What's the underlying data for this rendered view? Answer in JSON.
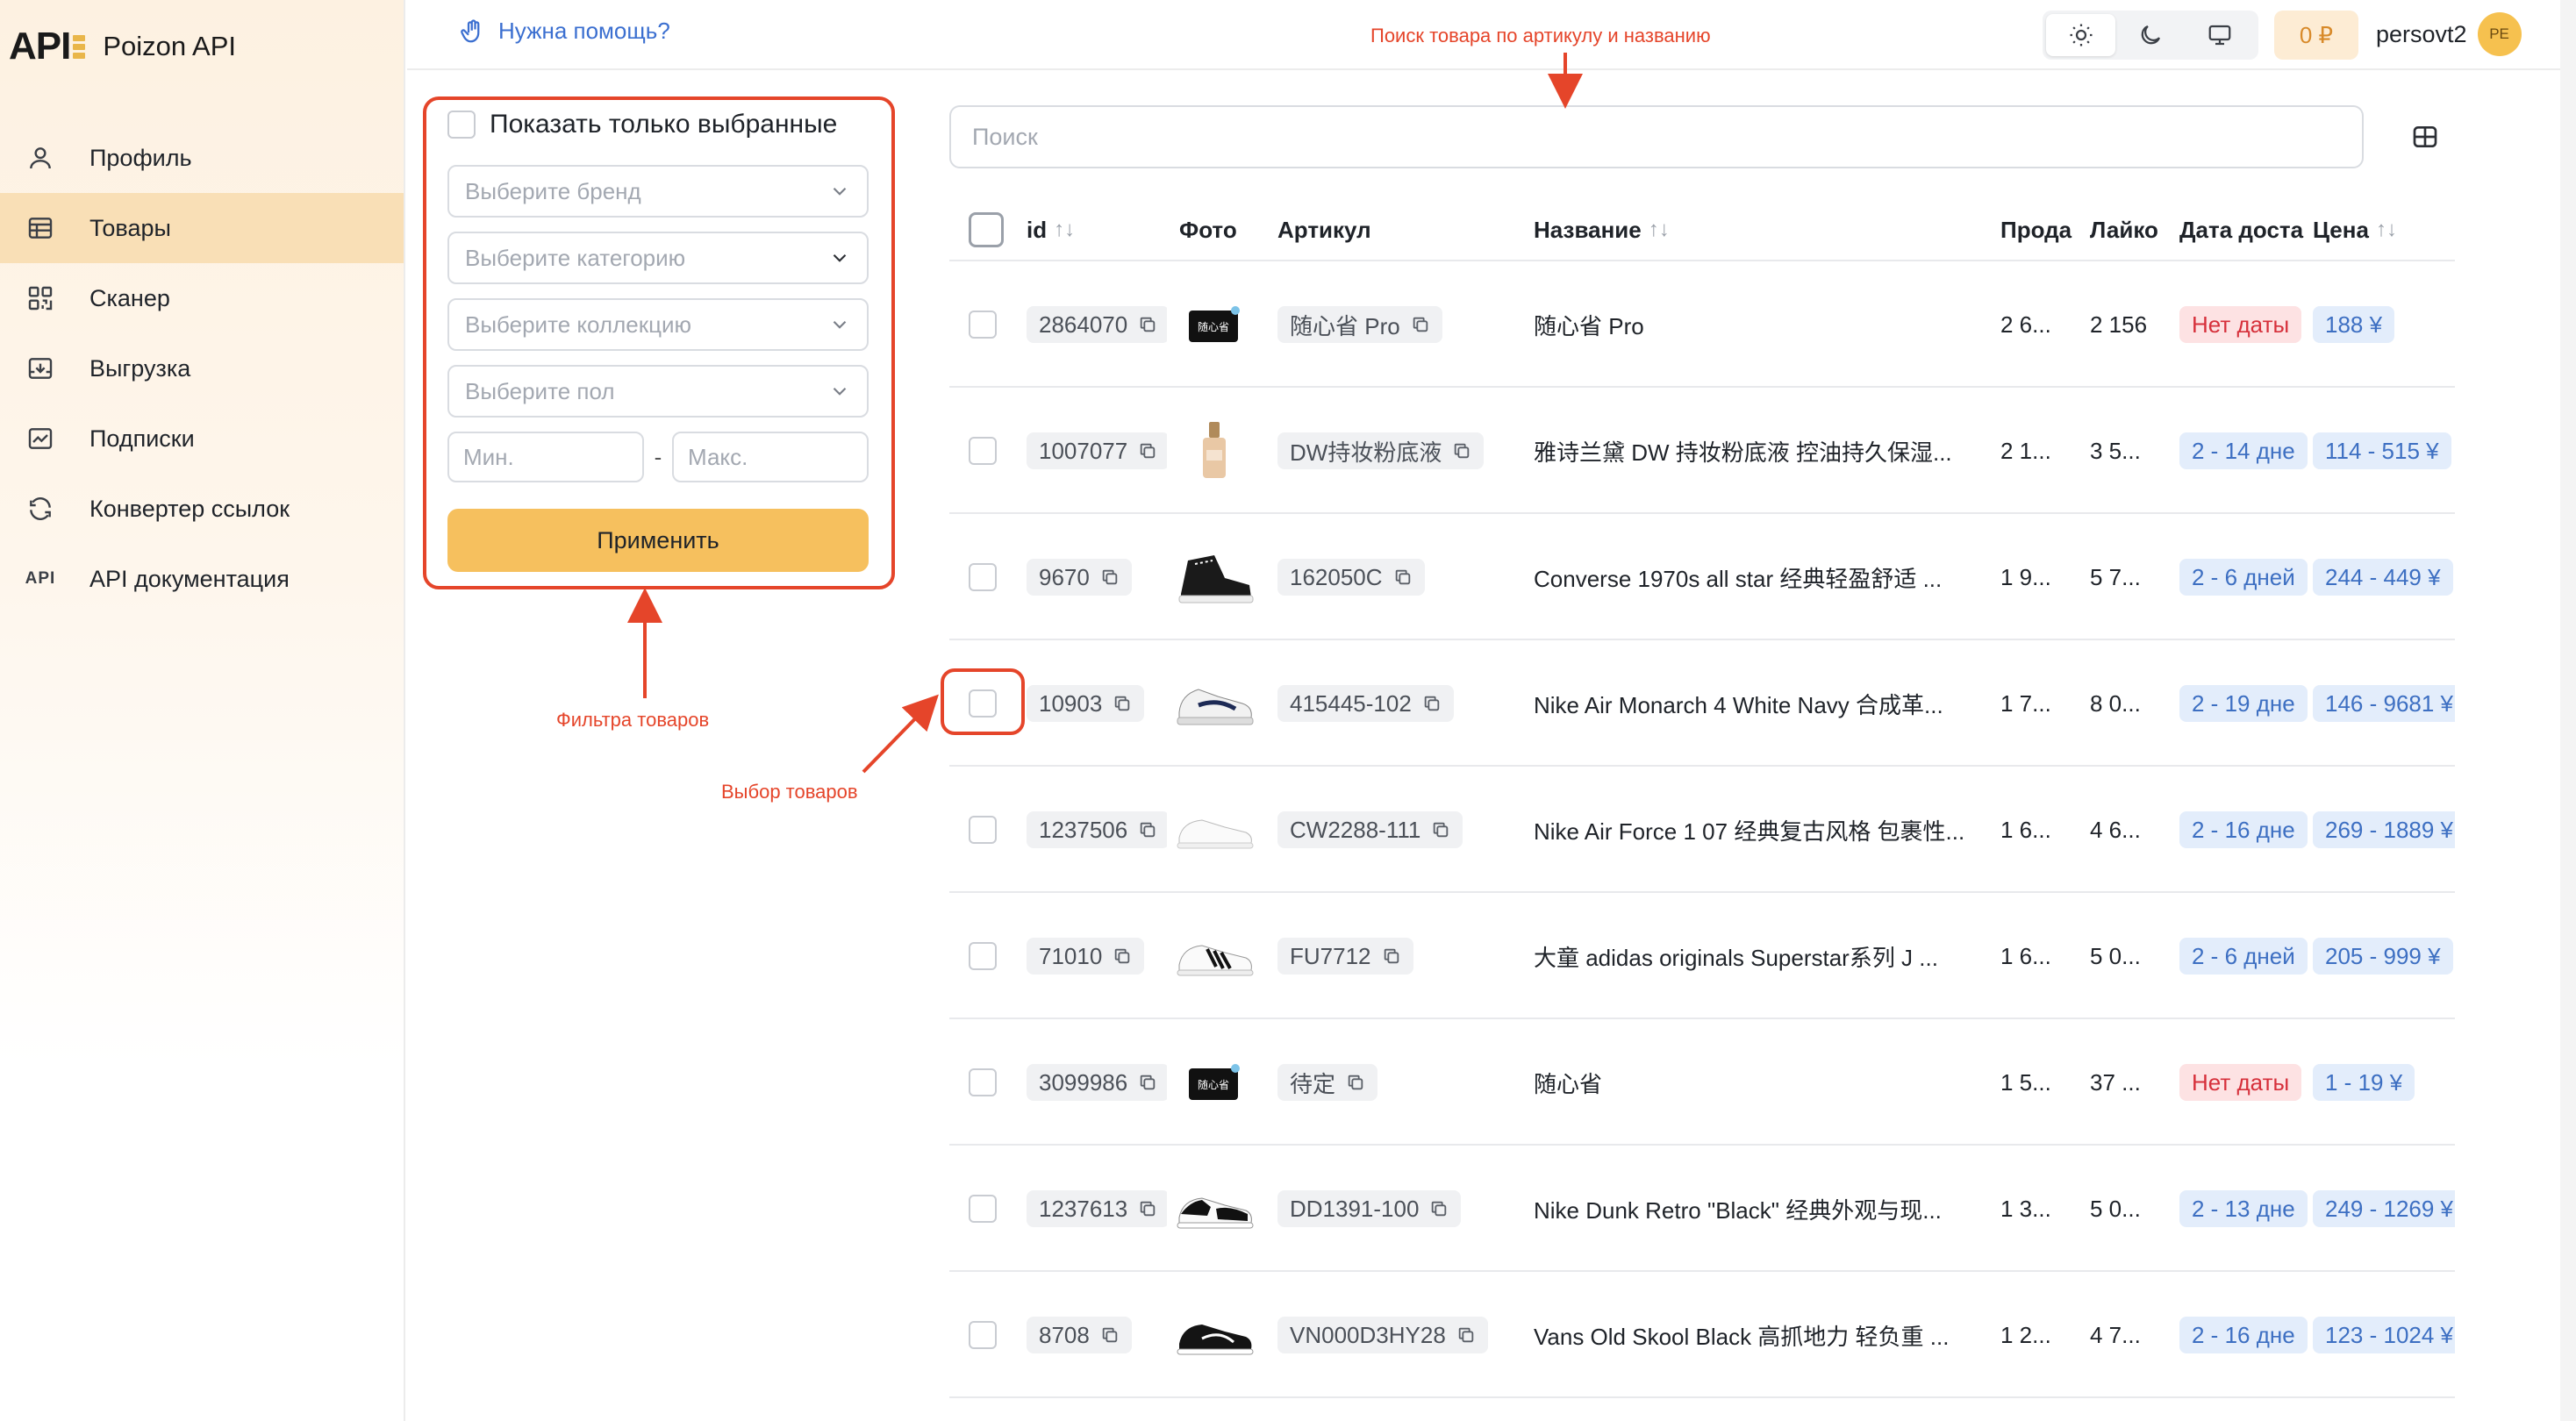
{
  "app": {
    "logo_text": "API",
    "title": "Poizon API"
  },
  "sidebar": {
    "items": [
      {
        "label": "Профиль",
        "icon": "user-icon",
        "active": false
      },
      {
        "label": "Товары",
        "icon": "table-icon",
        "active": true
      },
      {
        "label": "Сканер",
        "icon": "qr-scan-icon",
        "active": false
      },
      {
        "label": "Выгрузка",
        "icon": "download-tray-icon",
        "active": false
      },
      {
        "label": "Подписки",
        "icon": "chart-line-icon",
        "active": false
      },
      {
        "label": "Конвертер ссылок",
        "icon": "refresh-icon",
        "active": false
      },
      {
        "label": "API документация",
        "icon": "api-text-icon",
        "icon_text": "API",
        "active": false
      }
    ]
  },
  "header": {
    "help_label": "Нужна помощь?",
    "theme_modes": [
      "light",
      "dark",
      "system"
    ],
    "balance": "0 ₽",
    "username": "persovt2",
    "avatar_initials": "PE"
  },
  "filters": {
    "only_selected_label": "Показать только выбранные",
    "brand_placeholder": "Выберите бренд",
    "category_placeholder": "Выберите категорию",
    "collection_placeholder": "Выберите коллекцию",
    "gender_placeholder": "Выберите пол",
    "min_placeholder": "Мин.",
    "max_placeholder": "Макс.",
    "range_separator": "-",
    "apply_label": "Применить"
  },
  "annotations": {
    "search_hint": "Поиск товара по артикулу и названию",
    "filters_hint": "Фильтра товаров",
    "select_hint": "Выбор товаров"
  },
  "search": {
    "placeholder": "Поиск"
  },
  "table": {
    "columns": {
      "id": "id",
      "photo": "Фото",
      "article": "Артикул",
      "name": "Название",
      "sales": "Прода",
      "likes": "Лайко",
      "delivery": "Дата доста",
      "price": "Цена"
    },
    "rows": [
      {
        "id": "2864070",
        "photo": "brand-box",
        "article": "随心省 Pro",
        "name": "随心省 Pro",
        "sales": "2 6...",
        "likes": "2 156",
        "delivery": "Нет даты",
        "delivery_none": true,
        "price": "188 ¥"
      },
      {
        "id": "1007077",
        "photo": "bottle",
        "article": "DW持妆粉底液",
        "name": "雅诗兰黛 DW 持妆粉底液 控油持久保湿...",
        "sales": "2 1...",
        "likes": "3 5...",
        "delivery": "2 - 14 дне",
        "delivery_none": false,
        "price": "114 - 515 ¥"
      },
      {
        "id": "9670",
        "photo": "hightop-black",
        "article": "162050C",
        "name": "Converse 1970s all star 经典轻盈舒适 ...",
        "sales": "1 9...",
        "likes": "5 7...",
        "delivery": "2 - 6 дней",
        "delivery_none": false,
        "price": "244 - 449 ¥"
      },
      {
        "id": "10903",
        "photo": "sneaker-white-navy",
        "article": "415445-102",
        "name": "Nike Air Monarch 4 White Navy 合成革...",
        "sales": "1 7...",
        "likes": "8 0...",
        "delivery": "2 - 19 дне",
        "delivery_none": false,
        "price": "146 - 9681 ¥"
      },
      {
        "id": "1237506",
        "photo": "sneaker-white",
        "article": "CW2288-111",
        "name": "Nike Air Force 1 07 经典复古风格 包裹性...",
        "sales": "1 6...",
        "likes": "4 6...",
        "delivery": "2 - 16 дне",
        "delivery_none": false,
        "price": "269 - 1889 ¥"
      },
      {
        "id": "71010",
        "photo": "sneaker-stripes",
        "article": "FU7712",
        "name": "大童 adidas originals Superstar系列 J ...",
        "sales": "1 6...",
        "likes": "5 0...",
        "delivery": "2 - 6 дней",
        "delivery_none": false,
        "price": "205 - 999 ¥"
      },
      {
        "id": "3099986",
        "photo": "brand-box",
        "article": "待定",
        "name": "随心省",
        "sales": "1 5...",
        "likes": "37 ...",
        "delivery": "Нет даты",
        "delivery_none": true,
        "price": "1 - 19 ¥"
      },
      {
        "id": "1237613",
        "photo": "sneaker-panda",
        "article": "DD1391-100",
        "name": "Nike Dunk Retro \"Black\" 经典外观与现...",
        "sales": "1 3...",
        "likes": "5 0...",
        "delivery": "2 - 13 дне",
        "delivery_none": false,
        "price": "249 - 1269 ¥"
      },
      {
        "id": "8708",
        "photo": "sneaker-black-low",
        "article": "VN000D3HY28",
        "name": "Vans Old Skool Black 高抓地力 轻负重 ...",
        "sales": "1 2...",
        "likes": "4 7...",
        "delivery": "2 - 16 дне",
        "delivery_none": false,
        "price": "123 - 1024 ¥"
      }
    ]
  },
  "colors": {
    "accent": "#f6c05e",
    "annotation": "#e5452a",
    "badge_red_bg": "#fde2e3",
    "badge_blue_bg": "#e3edfb",
    "link": "#3b6fd0"
  }
}
